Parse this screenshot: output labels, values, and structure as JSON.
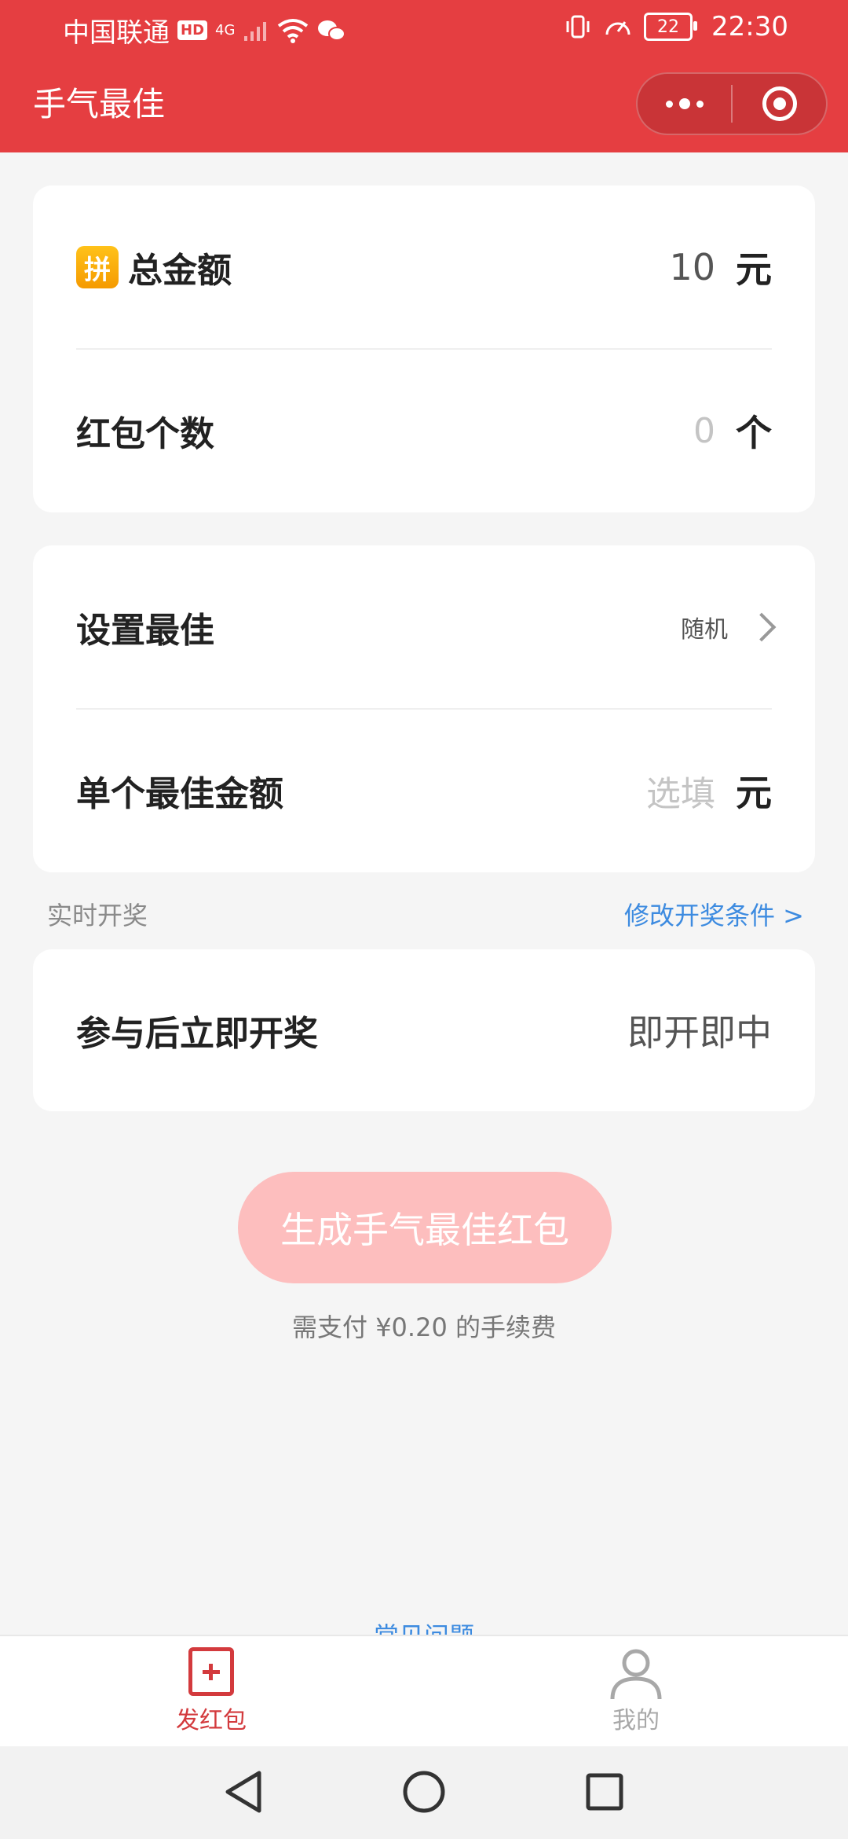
{
  "status_bar": {
    "carrier": "中国联通",
    "hd": "HD",
    "network": "4G",
    "battery": "22",
    "time": "22:30"
  },
  "nav": {
    "title": "手气最佳"
  },
  "amount_card": {
    "total_label": "总金额",
    "total_icon_char": "拼",
    "total_value": "10",
    "total_unit": "元",
    "count_label": "红包个数",
    "count_value": "0",
    "count_unit": "个"
  },
  "best_card": {
    "set_best_label": "设置最佳",
    "set_best_value": "随机",
    "single_best_label": "单个最佳金额",
    "single_best_placeholder": "选填",
    "single_best_unit": "元"
  },
  "draw_section": {
    "label": "实时开奖",
    "modify_link": "修改开奖条件 >",
    "row_label": "参与后立即开奖",
    "row_value": "即开即中"
  },
  "action": {
    "generate_button": "生成手气最佳红包",
    "fee_note": "需支付 ¥0.20 的手续费"
  },
  "faq": {
    "label": "常见问题"
  },
  "tab_bar": {
    "items": [
      {
        "label": "发红包",
        "icon": "add-square-icon",
        "active": true
      },
      {
        "label": "我的",
        "icon": "person-icon",
        "active": false
      }
    ]
  },
  "colors": {
    "brand_red": "#e53e41",
    "button_disabled": "#fdbebe",
    "link_blue": "#3d8be0"
  }
}
